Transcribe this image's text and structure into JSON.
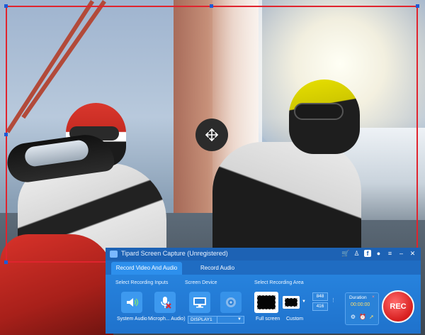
{
  "app": {
    "title": "Tipard Screen Capture (Unregistered)"
  },
  "titlebar_icons": [
    "cart-icon",
    "user-icon",
    "facebook-icon",
    "chat-icon",
    "menu-icon",
    "minimize-icon",
    "close-icon"
  ],
  "tabs": [
    {
      "label": "Record Video And Audio",
      "active": true
    },
    {
      "label": "Record Audio",
      "active": false
    }
  ],
  "sections": {
    "inputs": "Select Recording Inputs",
    "device": "Screen Device",
    "area": "Select Recording Area"
  },
  "inputs": {
    "system_audio": "System Audio",
    "microphone": "Microph... Audio)"
  },
  "device": {
    "selected": "DISPLAY1"
  },
  "area": {
    "full_screen": "Full screen",
    "custom": "Custom",
    "width": "848",
    "height": "416"
  },
  "duration": {
    "label": "Duration",
    "close": "×",
    "time": "00:00:00"
  },
  "rec_label": "REC",
  "colors": {
    "panel": "#2a8ae5",
    "selection": "#e0242e",
    "rec": "#d71e1e"
  }
}
